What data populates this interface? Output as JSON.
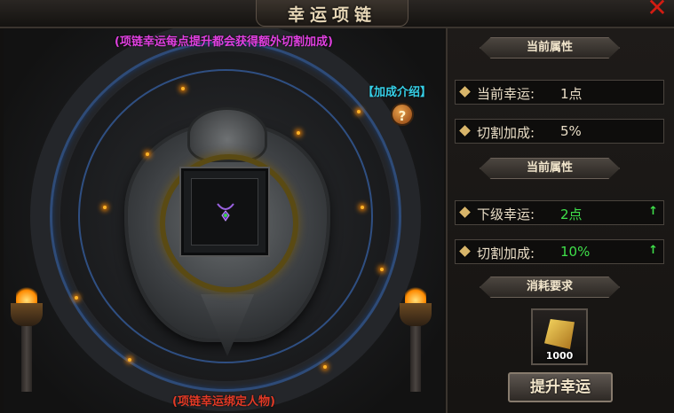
{
  "window": {
    "title": "幸运项链",
    "close_icon": "close-icon"
  },
  "stage": {
    "top_note": "(项链幸运每点提升都会获得额外切割加成)",
    "bottom_note": "(项链幸运绑定人物)",
    "intro_link": "【加成介绍】",
    "help_label": "?"
  },
  "panel": {
    "current_header": "当前属性",
    "current_luck_label": "当前幸运:",
    "current_luck_value": "1点",
    "current_cut_label": "切割加成:",
    "current_cut_value": "5%",
    "next_header": "当前属性",
    "next_luck_label": "下级幸运:",
    "next_luck_value": "2点",
    "next_cut_label": "切割加成:",
    "next_cut_value": "10%",
    "up_arrow": "↑",
    "cost_header": "消耗要求",
    "cost_quantity": "1000",
    "upgrade_button": "提升幸运"
  },
  "colors": {
    "top_note": "#e040e0",
    "bottom_note": "#e33a26",
    "intro_link": "#36d0e8",
    "next_value": "#3fe04a"
  }
}
